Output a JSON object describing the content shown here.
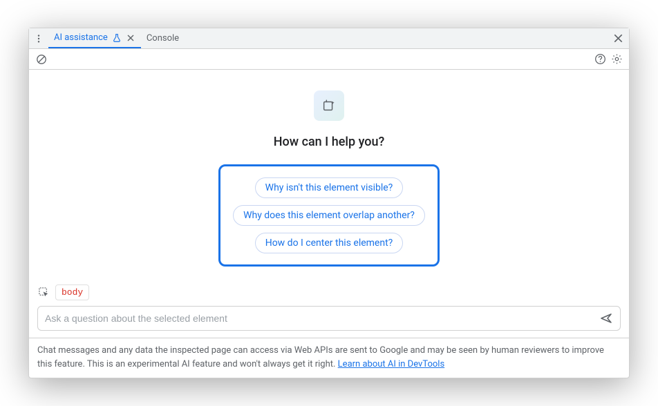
{
  "tabs": {
    "active": {
      "label": "AI assistance"
    },
    "secondary": {
      "label": "Console"
    }
  },
  "main": {
    "heading": "How can I help you?",
    "suggestions": [
      "Why isn't this element visible?",
      "Why does this element overlap another?",
      "How do I center this element?"
    ]
  },
  "context": {
    "selected_element": "body"
  },
  "input": {
    "placeholder": "Ask a question about the selected element"
  },
  "footer": {
    "text": "Chat messages and any data the inspected page can access via Web APIs are sent to Google and may be seen by human reviewers to improve this feature. This is an experimental AI feature and won't always get it right. ",
    "link_text": "Learn about AI in DevTools"
  }
}
